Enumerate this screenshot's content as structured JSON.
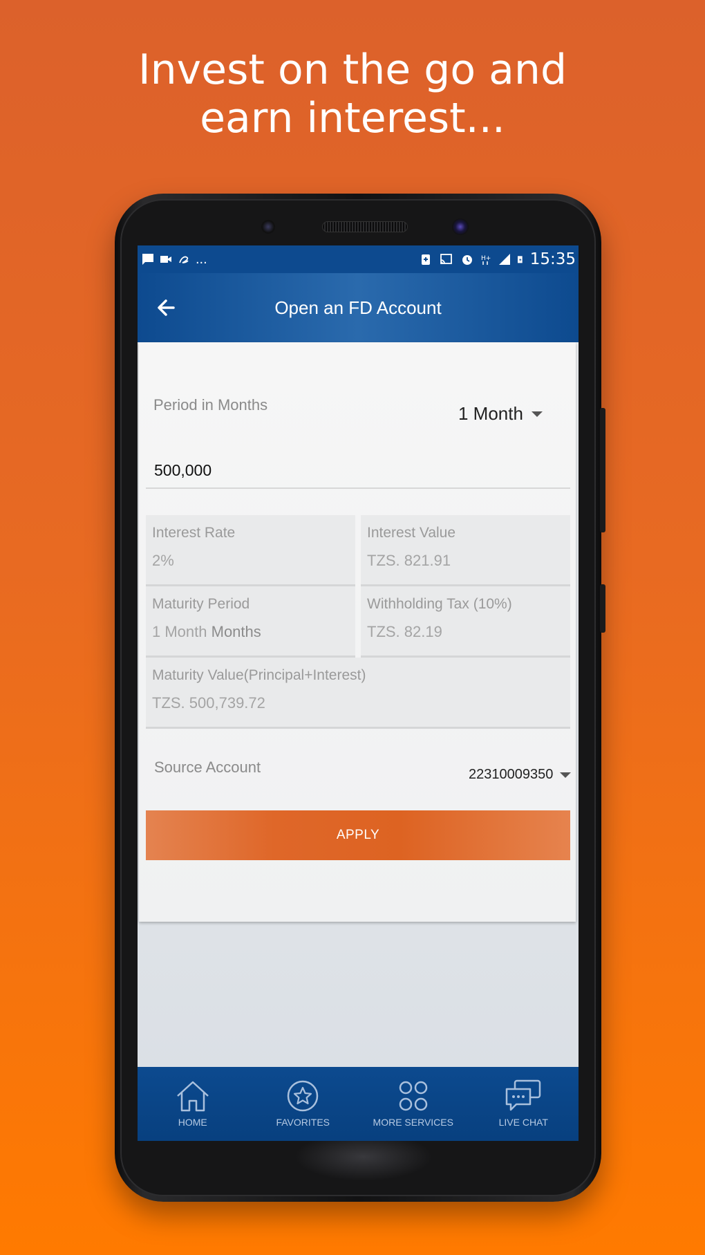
{
  "headline": {
    "line1": "Invest on the go and",
    "line2": "earn interest..."
  },
  "statusbar": {
    "time": "15:35",
    "overflow": "...",
    "icons": [
      "message-icon",
      "video-icon",
      "script-icon",
      "battery-saver-icon",
      "cast-icon",
      "alarm-icon",
      "hplus-icon",
      "signal-icon",
      "battery-icon"
    ]
  },
  "appbar": {
    "title": "Open an FD Account"
  },
  "form": {
    "period_label": "Period in Months",
    "period_value": "1 Month",
    "amount_value": "500,000",
    "interest_rate_label": "Interest Rate",
    "interest_rate_value": "2%",
    "interest_value_label": "Interest Value",
    "interest_value_value": "TZS. 821.91",
    "maturity_period_label": "Maturity Period",
    "maturity_period_value": "1 Month",
    "maturity_period_unit": "Months",
    "withholding_label": "Withholding Tax (10%)",
    "withholding_value": "TZS. 82.19",
    "maturity_value_label": "Maturity Value(Principal+Interest)",
    "maturity_value_value": "TZS. 500,739.72",
    "source_label": "Source Account",
    "source_value": "22310009350",
    "apply_label": "APPLY"
  },
  "nav": {
    "items": [
      {
        "label": "HOME",
        "icon": "home-icon"
      },
      {
        "label": "FAVORITES",
        "icon": "star-icon"
      },
      {
        "label": "MORE SERVICES",
        "icon": "grid-icon"
      },
      {
        "label": "LIVE CHAT",
        "icon": "chat-icon"
      }
    ]
  },
  "colors": {
    "background_top": "#dc612b",
    "background_bottom": "#ff7a00",
    "primary_blue": "#0d4a8f",
    "apply_orange": "#df6729"
  }
}
